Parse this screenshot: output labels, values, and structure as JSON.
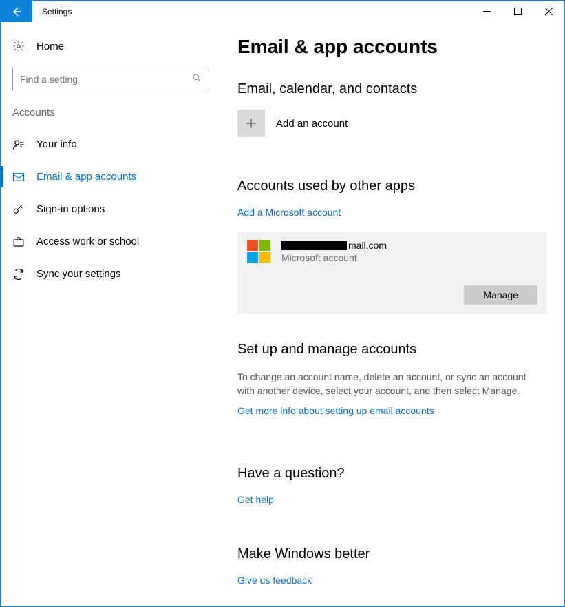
{
  "window": {
    "title": "Settings"
  },
  "sidebar": {
    "home": "Home",
    "search_placeholder": "Find a setting",
    "heading": "Accounts",
    "items": [
      {
        "label": "Your info"
      },
      {
        "label": "Email & app accounts"
      },
      {
        "label": "Sign-in options"
      },
      {
        "label": "Access work or school"
      },
      {
        "label": "Sync your settings"
      }
    ]
  },
  "main": {
    "title": "Email & app accounts",
    "email_section": {
      "heading": "Email, calendar, and contacts",
      "add_label": "Add an account"
    },
    "other_apps": {
      "heading": "Accounts used by other apps",
      "add_ms_link": "Add a Microsoft account",
      "account": {
        "email_suffix": "mail.com",
        "type": "Microsoft account",
        "manage": "Manage"
      }
    },
    "setup": {
      "heading": "Set up and manage accounts",
      "desc": "To change an account name, delete an account, or sync an account with another device, select your account, and then select Manage.",
      "link": "Get more info about setting up email accounts"
    },
    "question": {
      "heading": "Have a question?",
      "link": "Get help"
    },
    "feedback": {
      "heading": "Make Windows better",
      "link": "Give us feedback"
    }
  }
}
